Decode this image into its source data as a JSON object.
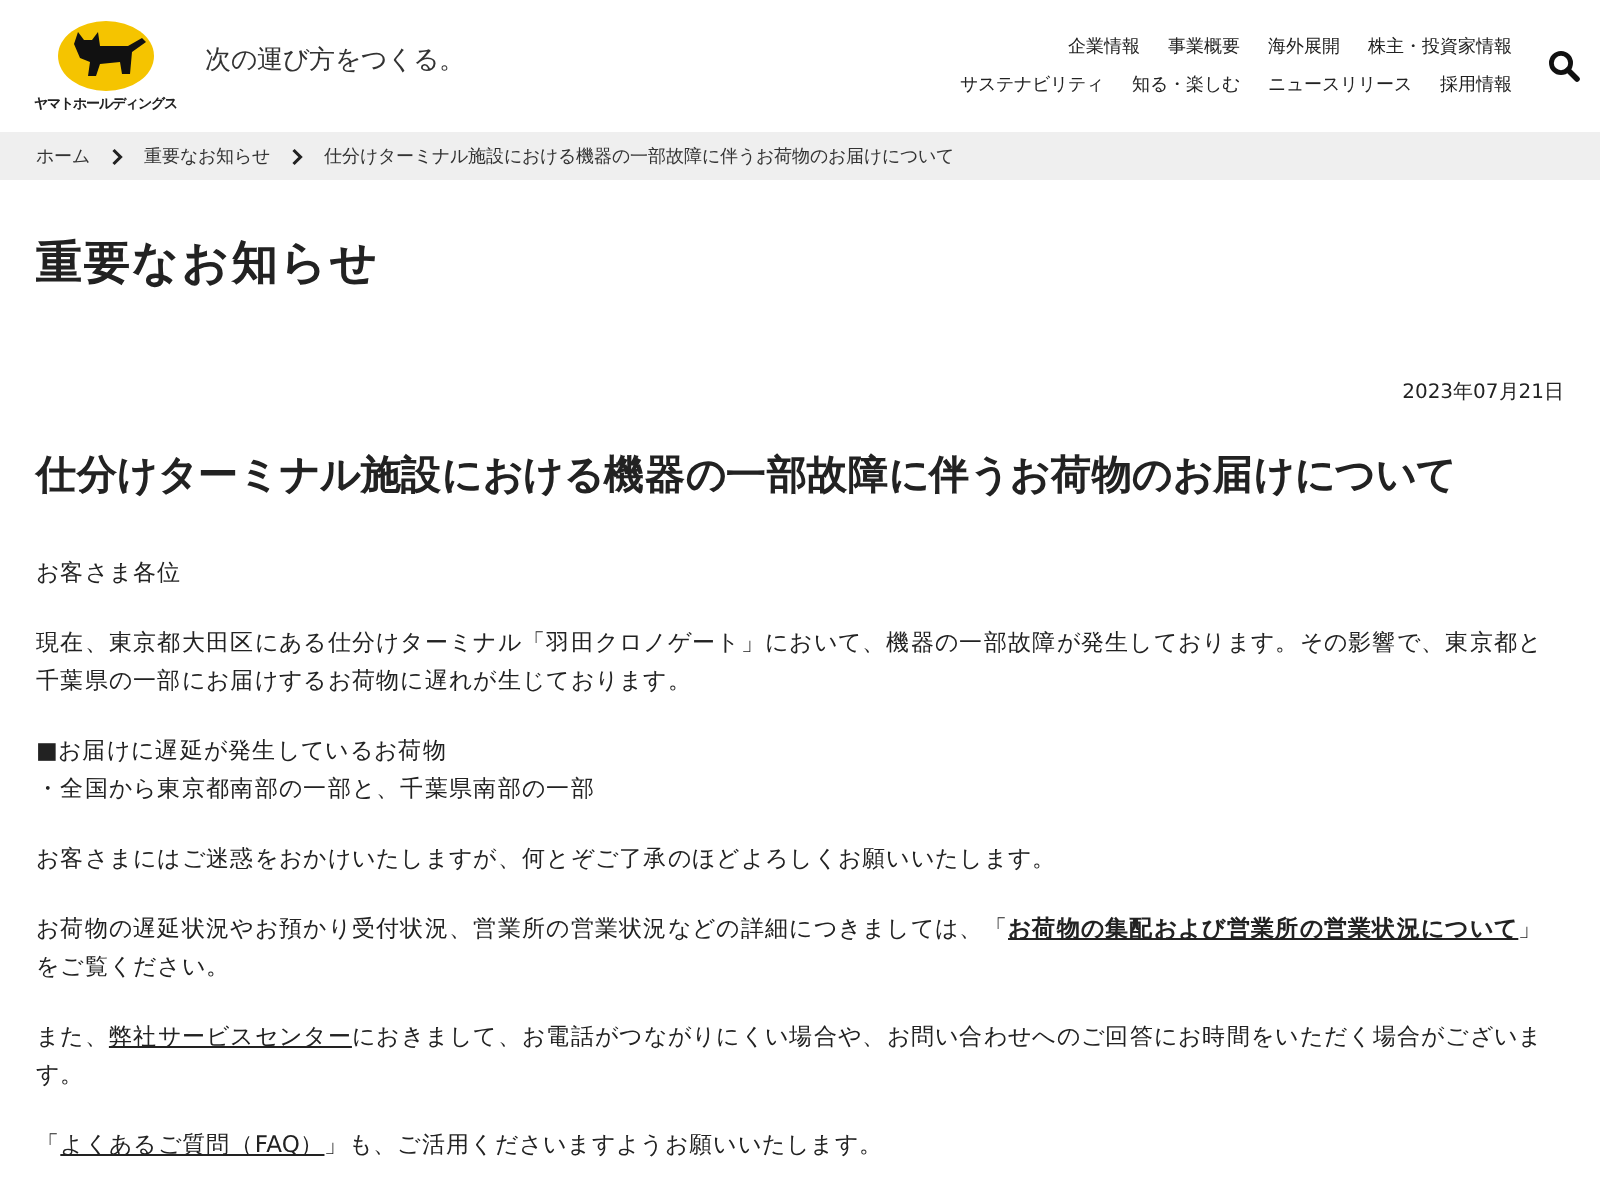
{
  "header": {
    "logo_text": "ヤマトホールディングス",
    "tagline": "次の運び方をつくる。",
    "nav_rows": [
      [
        "企業情報",
        "事業概要",
        "海外展開",
        "株主・投資家情報"
      ],
      [
        "サステナビリティ",
        "知る・楽しむ",
        "ニュースリリース",
        "採用情報"
      ]
    ]
  },
  "breadcrumb": [
    "ホーム",
    "重要なお知らせ",
    "仕分けターミナル施設における機器の一部故障に伴うお荷物のお届けについて"
  ],
  "page_title": "重要なお知らせ",
  "date": "2023年07月21日",
  "article_title": "仕分けターミナル施設における機器の一部故障に伴うお荷物のお届けについて",
  "paragraphs": [
    {
      "parts": [
        {
          "kind": "text",
          "text": "お客さま各位"
        }
      ]
    },
    {
      "parts": [
        {
          "kind": "text",
          "text": "現在、東京都大田区にある仕分けターミナル「羽田クロノゲート」において、機器の一部故障が発生しております。その影響で、東京都と千葉県の一部にお届けするお荷物に遅れが生じております。"
        }
      ]
    },
    {
      "lines": [
        "■お届けに遅延が発生しているお荷物",
        "・全国から東京都南部の一部と、千葉県南部の一部"
      ]
    },
    {
      "parts": [
        {
          "kind": "text",
          "text": "お客さまにはご迷惑をおかけいたしますが、何とぞご了承のほどよろしくお願いいたします。"
        }
      ]
    },
    {
      "parts": [
        {
          "kind": "text",
          "text": "お荷物の遅延状況やお預かり受付状況、営業所の営業状況などの詳細につきましては、「"
        },
        {
          "kind": "strong_link",
          "text": "お荷物の集配および営業所の営業状況について"
        },
        {
          "kind": "text",
          "text": "」をご覧ください。"
        }
      ]
    },
    {
      "parts": [
        {
          "kind": "text",
          "text": "また、"
        },
        {
          "kind": "link",
          "text": "弊社サービスセンター"
        },
        {
          "kind": "text",
          "text": "におきまして、お電話がつながりにくい場合や、お問い合わせへのご回答にお時間をいただく場合がございます。"
        }
      ]
    },
    {
      "parts": [
        {
          "kind": "text",
          "text": "「"
        },
        {
          "kind": "link",
          "text": "よくあるご質問（FAQ）"
        },
        {
          "kind": "text",
          "text": "」も、ご活用くださいますようお願いいたします。"
        }
      ]
    }
  ]
}
